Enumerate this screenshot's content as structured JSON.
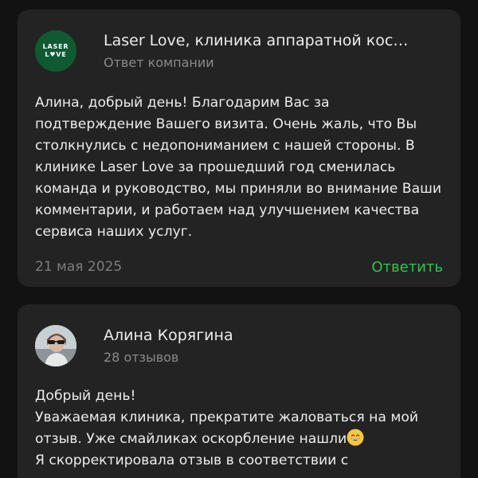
{
  "reply": {
    "company_name": "Laser Love, клиника аппаратной кос…",
    "role": "Ответ компании",
    "logo_line1": "LASER",
    "logo_line2": "L♥VE",
    "text": "Алина, добрый день! Благодарим Вас за подтверждение Вашего визита. Очень жаль, что Вы столкнулись с недопониманием с нашей стороны. В клинике Laser Love за прошедший год сменилась команда и руководство, мы приняли во внимание Ваши комментарии, и работаем над улучшением качества сервиса наших услуг.",
    "date": "21 мая 2025",
    "reply_label": "Ответить"
  },
  "review": {
    "author_name": "Алина Корягина",
    "reviews_count": "28 отзывов",
    "line1": "Добрый день!",
    "line2": "Уважаемая клиника, прекратите жаловаться на мой отзыв. Уже смайликах оскорбление нашли",
    "emoji": "grinning-face-emoji",
    "line3": " Я скорректировала отзыв в соответствии с"
  },
  "colors": {
    "background": "#121212",
    "card": "#232323",
    "accent_green": "#33c24f",
    "logo_green": "#0f5a32"
  }
}
